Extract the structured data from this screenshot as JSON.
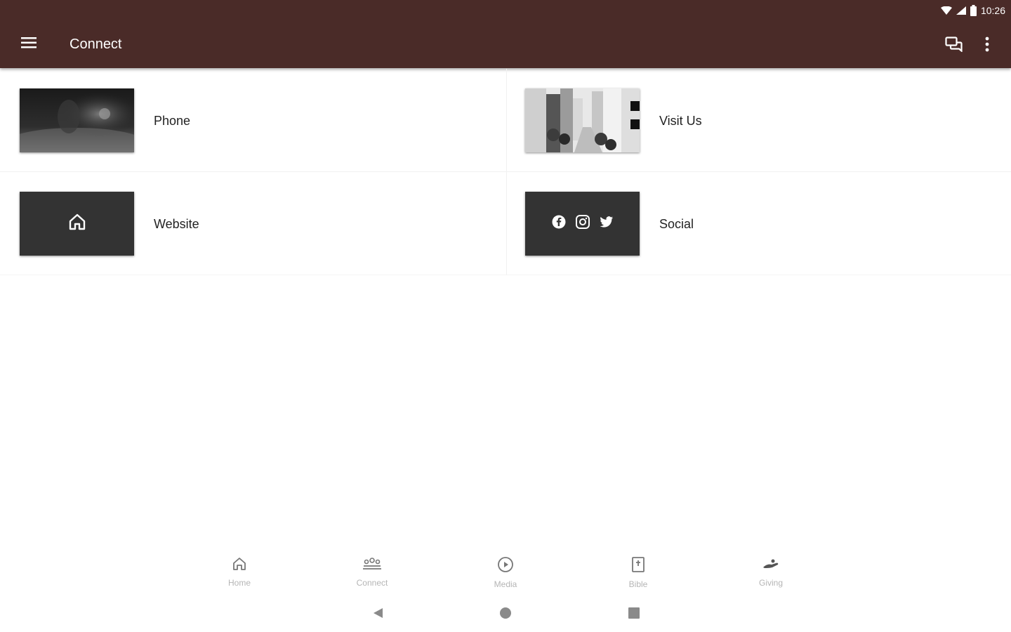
{
  "status_bar": {
    "time": "10:26"
  },
  "app_bar": {
    "title": "Connect",
    "background": "#4a2b28"
  },
  "tiles": [
    {
      "label": "Phone",
      "thumbnail": "phone-photo"
    },
    {
      "label": "Visit Us",
      "thumbnail": "city-street-photo"
    },
    {
      "label": "Website",
      "thumbnail": "home-icon"
    },
    {
      "label": "Social",
      "thumbnail": "social-icons"
    }
  ],
  "bottom_nav": {
    "items": [
      {
        "label": "Home",
        "icon": "home-icon"
      },
      {
        "label": "Connect",
        "icon": "people-icon"
      },
      {
        "label": "Media",
        "icon": "play-circle-icon"
      },
      {
        "label": "Bible",
        "icon": "book-icon"
      },
      {
        "label": "Giving",
        "icon": "giving-hand-icon"
      }
    ]
  },
  "system_nav": {
    "buttons": [
      "back-icon",
      "home-circle-icon",
      "recents-icon"
    ]
  }
}
